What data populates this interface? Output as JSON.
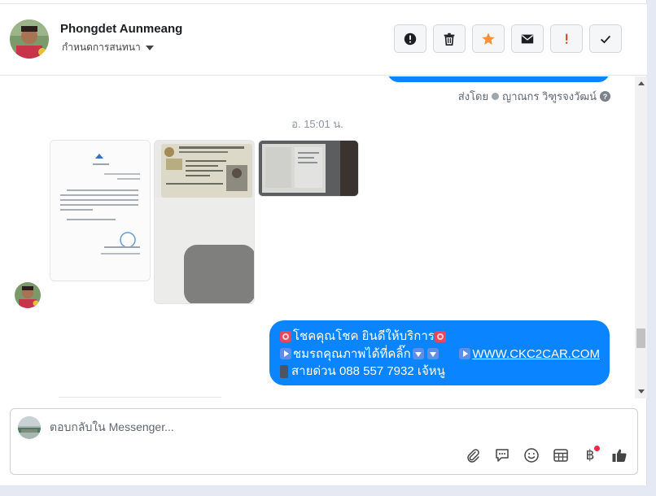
{
  "header": {
    "name": "Phongdet Aunmeang",
    "subtitle": "กำหนดการสนทนา",
    "actions": [
      {
        "name": "report-icon"
      },
      {
        "name": "trash-icon"
      },
      {
        "name": "star-icon",
        "color": "#f7923a"
      },
      {
        "name": "envelope-icon"
      },
      {
        "name": "exclamation-icon",
        "color": "#e0452c"
      },
      {
        "name": "check-icon"
      }
    ]
  },
  "conversation": {
    "sent_by_label": "ส่งโดย",
    "sent_by_name": "ญาณกร วิฑูรจงวัฒน์",
    "help_glyph": "?",
    "timestamp": "อ. 15:01 น.",
    "message": {
      "line1": "โชคคุณโชค ยินดีให้บริการ",
      "line2_text": "ชมรถคุณภาพได้ที่คลิ๊ก",
      "line2_link": "WWW.CKC2CAR.COM",
      "line3": "สายด่วน 088 557 7932 เจ้หนู"
    },
    "bubble_color": "#0b84ff"
  },
  "composer": {
    "placeholder": "ตอบกลับใน Messenger...",
    "tools": [
      {
        "name": "paperclip-icon"
      },
      {
        "name": "chat-bubble-icon"
      },
      {
        "name": "emoji-icon"
      },
      {
        "name": "table-icon"
      },
      {
        "name": "baht-icon",
        "glyph": "฿"
      },
      {
        "name": "thumbs-up-icon"
      }
    ]
  }
}
